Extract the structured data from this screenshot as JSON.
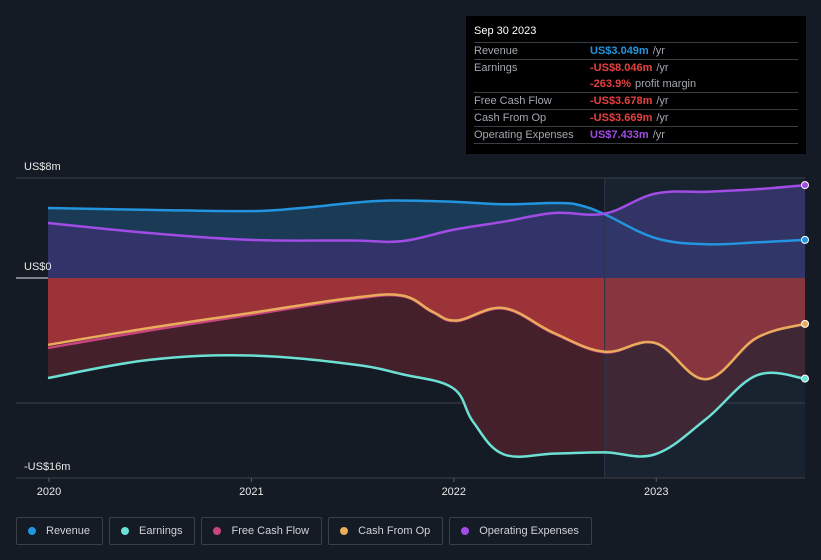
{
  "tooltip": {
    "date": "Sep 30 2023",
    "rows": [
      {
        "label": "Revenue",
        "value": "US$3.049m",
        "unit": "/yr",
        "color": "#2394df"
      },
      {
        "label": "Earnings",
        "value": "-US$8.046m",
        "unit": "/yr",
        "color": "#e64141"
      },
      {
        "label": "",
        "value": "-263.9%",
        "unit": "profit margin",
        "color": "#e64141"
      },
      {
        "label": "Free Cash Flow",
        "value": "-US$3.678m",
        "unit": "/yr",
        "color": "#e64141"
      },
      {
        "label": "Cash From Op",
        "value": "-US$3.669m",
        "unit": "/yr",
        "color": "#e64141"
      },
      {
        "label": "Operating Expenses",
        "value": "US$7.433m",
        "unit": "/yr",
        "color": "#a04ce5"
      }
    ]
  },
  "legend": [
    {
      "label": "Revenue",
      "color": "#2394df"
    },
    {
      "label": "Earnings",
      "color": "#6ce0d4"
    },
    {
      "label": "Free Cash Flow",
      "color": "#c8457f"
    },
    {
      "label": "Cash From Op",
      "color": "#e8ac5b"
    },
    {
      "label": "Operating Expenses",
      "color": "#a04ce5"
    }
  ],
  "chart_data": {
    "type": "area",
    "title": "",
    "xlabel": "",
    "ylabel": "",
    "ylim": [
      -16,
      8
    ],
    "xlim": [
      2020.0,
      2023.74
    ],
    "y_tick_labels": [
      {
        "value": 8,
        "label": "US$8m"
      },
      {
        "value": 0,
        "label": "US$0"
      },
      {
        "value": -16,
        "label": "-US$16m"
      }
    ],
    "y_gridlines": [
      8,
      0,
      -10,
      -16
    ],
    "x_ticks": [
      {
        "value": 2020,
        "label": "2020"
      },
      {
        "value": 2021,
        "label": "2021"
      },
      {
        "value": 2022,
        "label": "2022"
      },
      {
        "value": 2023,
        "label": "2023"
      }
    ],
    "highlight_from": 2022.75,
    "grid": true,
    "legend_position": "bottom",
    "units": "US$m",
    "series": [
      {
        "name": "Revenue",
        "color": "#2394df",
        "x": [
          2020.0,
          2020.5,
          2021.0,
          2021.25,
          2021.5,
          2021.7,
          2022.0,
          2022.25,
          2022.5,
          2022.62,
          2022.75,
          2023.0,
          2023.25,
          2023.5,
          2023.74
        ],
        "y": [
          5.6,
          5.45,
          5.35,
          5.6,
          6.0,
          6.2,
          6.1,
          5.9,
          6.0,
          5.85,
          5.1,
          3.2,
          2.7,
          2.85,
          3.049
        ]
      },
      {
        "name": "Operating Expenses",
        "color": "#a04ce5",
        "x": [
          2020.0,
          2020.5,
          2021.0,
          2021.5,
          2021.75,
          2022.0,
          2022.25,
          2022.5,
          2022.75,
          2023.0,
          2023.25,
          2023.5,
          2023.74
        ],
        "y": [
          4.4,
          3.6,
          3.05,
          3.0,
          2.95,
          3.85,
          4.5,
          5.2,
          5.15,
          6.75,
          6.9,
          7.1,
          7.433
        ]
      },
      {
        "name": "Free Cash Flow",
        "color": "#c8457f",
        "x": [
          2020.0,
          2020.5,
          2021.0,
          2021.5,
          2021.75,
          2021.9,
          2022.02,
          2022.25,
          2022.5,
          2022.75,
          2023.0,
          2023.25,
          2023.5,
          2023.74
        ],
        "y": [
          -5.6,
          -4.2,
          -2.95,
          -1.7,
          -1.45,
          -2.75,
          -3.45,
          -2.45,
          -4.45,
          -5.95,
          -5.2,
          -8.1,
          -4.8,
          -3.678
        ]
      },
      {
        "name": "Cash From Op",
        "color": "#e8ac5b",
        "x": [
          2020.0,
          2020.5,
          2021.0,
          2021.5,
          2021.75,
          2021.9,
          2022.02,
          2022.25,
          2022.5,
          2022.75,
          2023.0,
          2023.25,
          2023.5,
          2023.74
        ],
        "y": [
          -5.35,
          -4.0,
          -2.8,
          -1.6,
          -1.4,
          -2.7,
          -3.4,
          -2.4,
          -4.4,
          -5.9,
          -5.2,
          -8.1,
          -4.8,
          -3.669
        ]
      },
      {
        "name": "Earnings",
        "color": "#6ce0d4",
        "x": [
          2020.0,
          2020.5,
          2021.0,
          2021.5,
          2021.75,
          2022.0,
          2022.1,
          2022.25,
          2022.5,
          2022.75,
          2023.0,
          2023.25,
          2023.5,
          2023.74
        ],
        "y": [
          -8.0,
          -6.55,
          -6.2,
          -6.9,
          -7.7,
          -8.8,
          -11.5,
          -14.1,
          -14.05,
          -13.95,
          -14.1,
          -11.3,
          -7.8,
          -8.046
        ]
      }
    ]
  }
}
